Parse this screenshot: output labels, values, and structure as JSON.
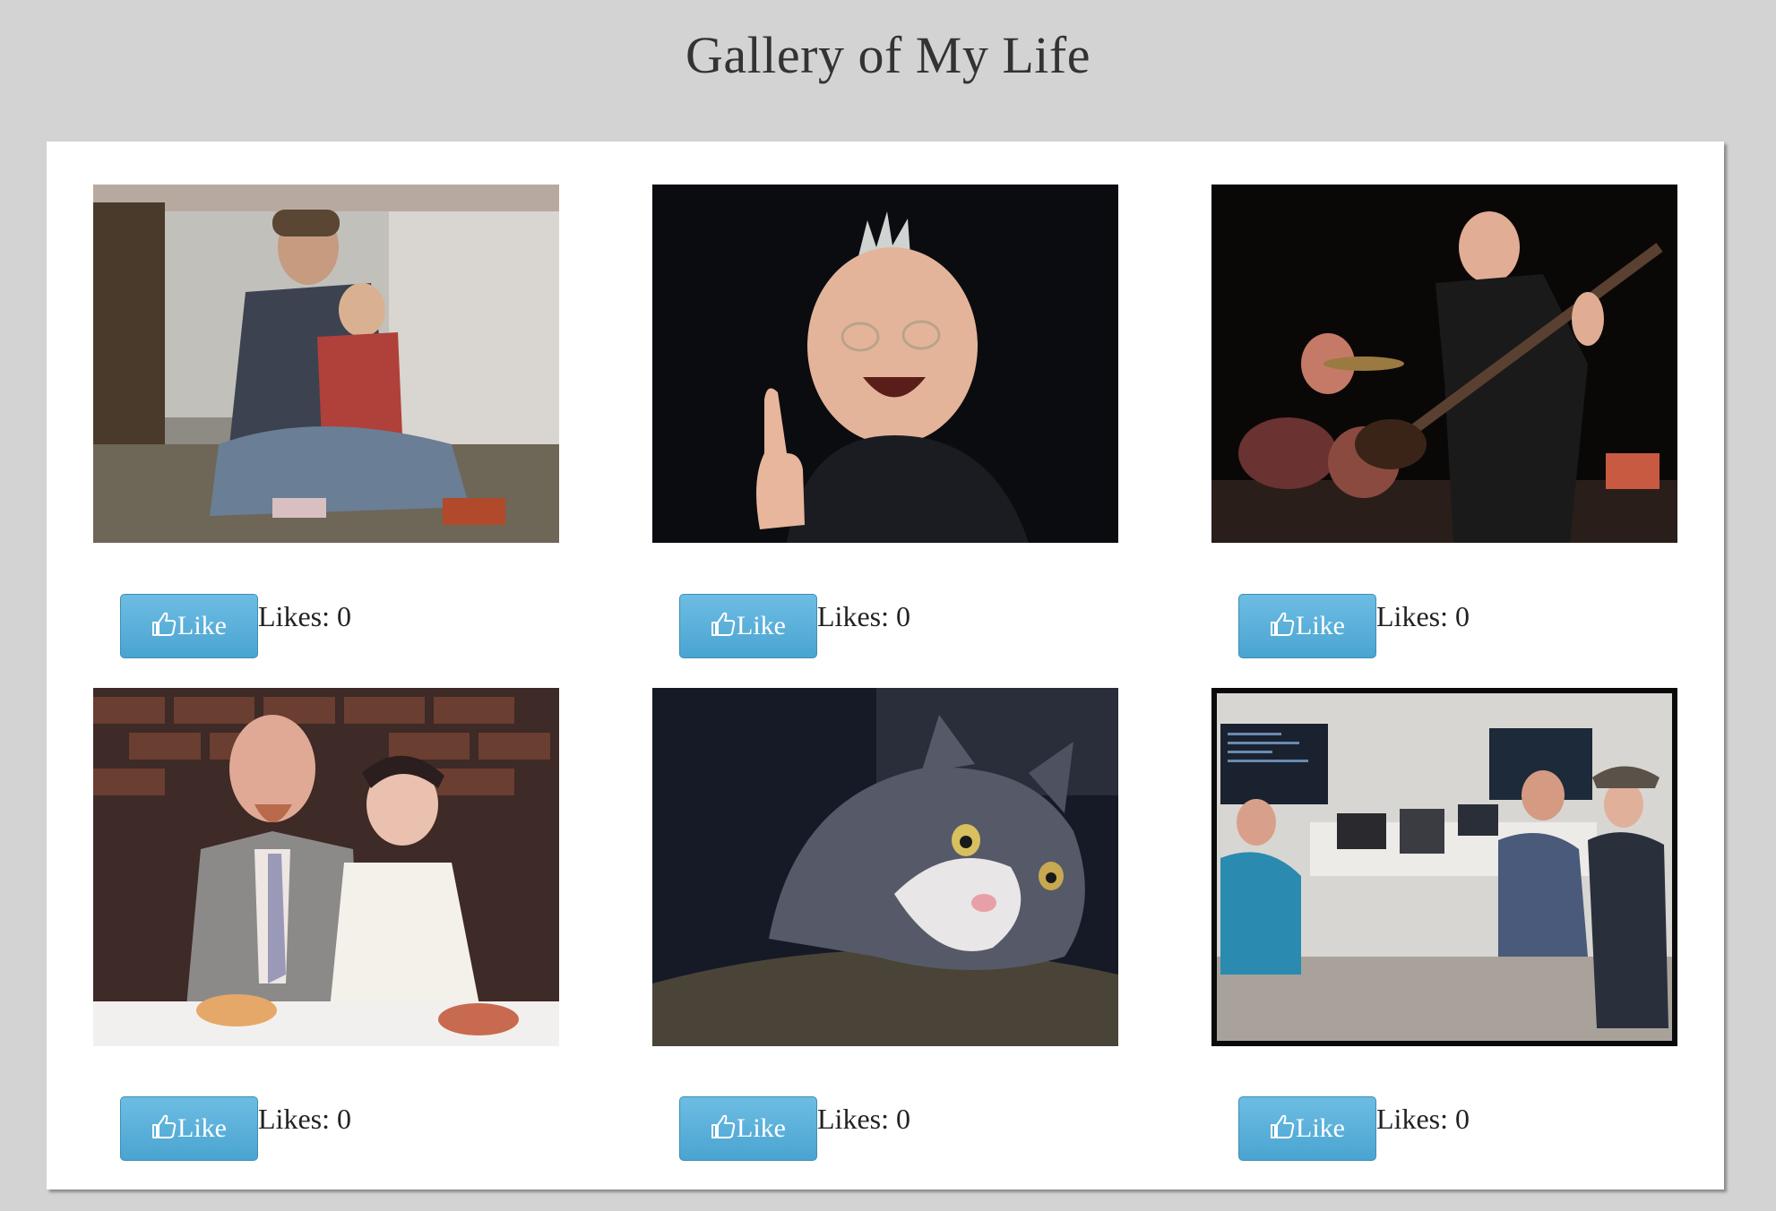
{
  "page": {
    "title": "Gallery of My Life"
  },
  "gallery": {
    "items": [
      {
        "photo": "father holding toddler on floor",
        "like_label": "Like",
        "likes_text": "Likes: 0"
      },
      {
        "photo": "man with spiky mohawk giving thumbs up",
        "like_label": "Like",
        "likes_text": "Likes: 0"
      },
      {
        "photo": "man playing bass guitar on stage with drummer",
        "like_label": "Like",
        "likes_text": "Likes: 0"
      },
      {
        "photo": "wedding couple seated at dinner table",
        "like_label": "Like",
        "likes_text": "Likes: 0"
      },
      {
        "photo": "gray and white cat lying on blanket",
        "like_label": "Like",
        "likes_text": "Likes: 0"
      },
      {
        "photo": "group of developers at laptops in office",
        "like_label": "Like",
        "likes_text": "Likes: 0"
      }
    ]
  },
  "colors": {
    "background": "#d3d3d3",
    "panel": "#ffffff",
    "button": "#5bb0db",
    "button_text": "#ffffff"
  },
  "icons": {
    "like_button_icon": "thumbs-up-icon"
  }
}
